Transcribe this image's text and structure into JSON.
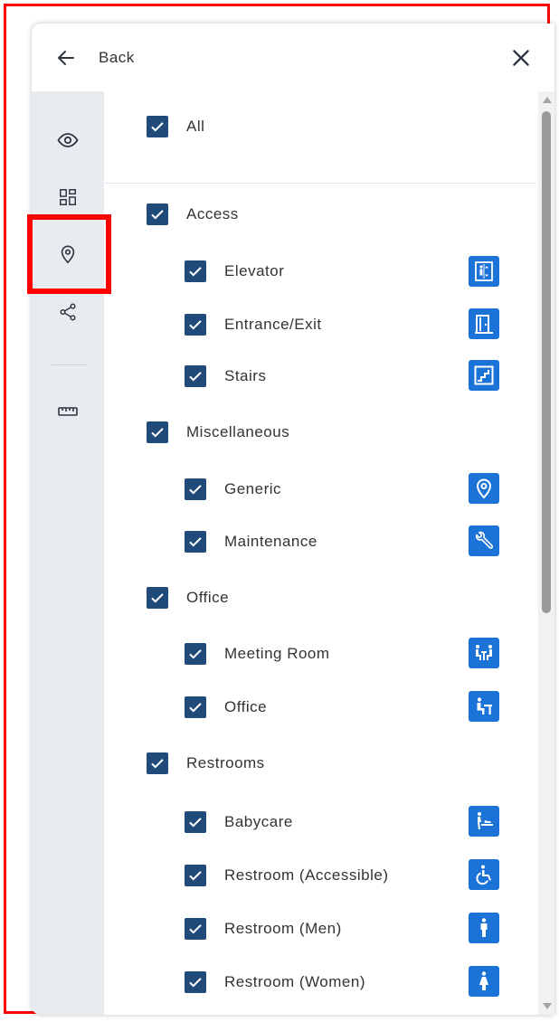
{
  "header": {
    "back_label": "Back",
    "back_icon": "arrow-left-icon",
    "close_icon": "close-icon"
  },
  "sidebar": {
    "items": [
      {
        "name": "eye-icon"
      },
      {
        "name": "layout-grid-icon"
      },
      {
        "name": "map-pin-icon",
        "active": true
      },
      {
        "name": "share-icon"
      },
      {
        "name": "ruler-icon"
      }
    ]
  },
  "filters": {
    "all_label": "All",
    "categories": [
      {
        "label": "Access",
        "checked": true,
        "items": [
          {
            "label": "Elevator",
            "checked": true,
            "icon": "elevator-icon"
          },
          {
            "label": "Entrance/Exit",
            "checked": true,
            "icon": "door-icon"
          },
          {
            "label": "Stairs",
            "checked": true,
            "icon": "stairs-icon"
          }
        ]
      },
      {
        "label": "Miscellaneous",
        "checked": true,
        "items": [
          {
            "label": "Generic",
            "checked": true,
            "icon": "map-pin-icon"
          },
          {
            "label": "Maintenance",
            "checked": true,
            "icon": "wrench-icon"
          }
        ]
      },
      {
        "label": "Office",
        "checked": true,
        "items": [
          {
            "label": "Meeting Room",
            "checked": true,
            "icon": "meeting-room-icon"
          },
          {
            "label": "Office",
            "checked": true,
            "icon": "office-desk-icon"
          }
        ]
      },
      {
        "label": "Restrooms",
        "checked": true,
        "items": [
          {
            "label": "Babycare",
            "checked": true,
            "icon": "babycare-icon"
          },
          {
            "label": "Restroom (Accessible)",
            "checked": true,
            "icon": "wheelchair-icon"
          },
          {
            "label": "Restroom (Men)",
            "checked": true,
            "icon": "man-icon"
          },
          {
            "label": "Restroom (Women)",
            "checked": true,
            "icon": "woman-icon"
          }
        ]
      }
    ]
  },
  "colors": {
    "checkbox": "#1f4a7a",
    "poi_icon_bg": "#1b73d8",
    "sidebar_bg": "#e8ebef",
    "annotation_red": "#ff0000"
  }
}
